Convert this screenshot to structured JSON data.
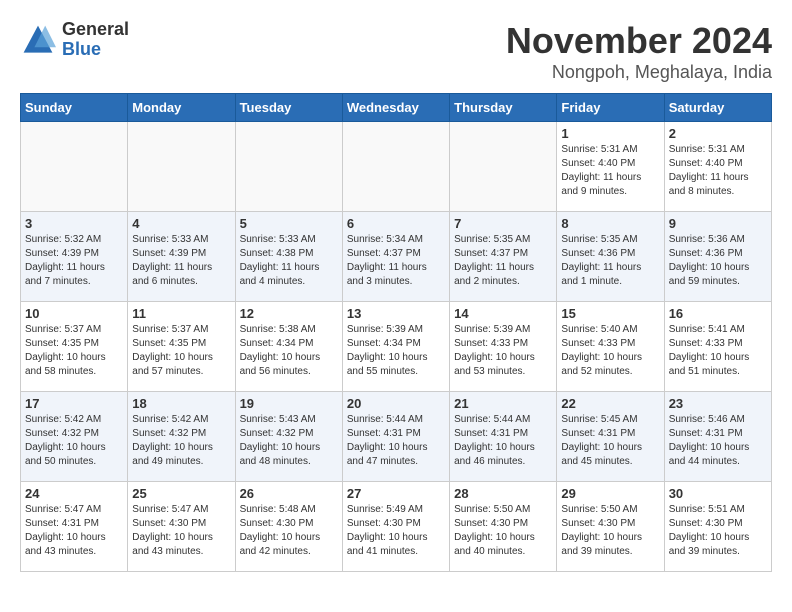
{
  "header": {
    "logo_general": "General",
    "logo_blue": "Blue",
    "month_title": "November 2024",
    "location": "Nongpoh, Meghalaya, India"
  },
  "weekdays": [
    "Sunday",
    "Monday",
    "Tuesday",
    "Wednesday",
    "Thursday",
    "Friday",
    "Saturday"
  ],
  "weeks": [
    {
      "days": [
        {
          "num": "",
          "info": ""
        },
        {
          "num": "",
          "info": ""
        },
        {
          "num": "",
          "info": ""
        },
        {
          "num": "",
          "info": ""
        },
        {
          "num": "",
          "info": ""
        },
        {
          "num": "1",
          "info": "Sunrise: 5:31 AM\nSunset: 4:40 PM\nDaylight: 11 hours\nand 9 minutes."
        },
        {
          "num": "2",
          "info": "Sunrise: 5:31 AM\nSunset: 4:40 PM\nDaylight: 11 hours\nand 8 minutes."
        }
      ]
    },
    {
      "days": [
        {
          "num": "3",
          "info": "Sunrise: 5:32 AM\nSunset: 4:39 PM\nDaylight: 11 hours\nand 7 minutes."
        },
        {
          "num": "4",
          "info": "Sunrise: 5:33 AM\nSunset: 4:39 PM\nDaylight: 11 hours\nand 6 minutes."
        },
        {
          "num": "5",
          "info": "Sunrise: 5:33 AM\nSunset: 4:38 PM\nDaylight: 11 hours\nand 4 minutes."
        },
        {
          "num": "6",
          "info": "Sunrise: 5:34 AM\nSunset: 4:37 PM\nDaylight: 11 hours\nand 3 minutes."
        },
        {
          "num": "7",
          "info": "Sunrise: 5:35 AM\nSunset: 4:37 PM\nDaylight: 11 hours\nand 2 minutes."
        },
        {
          "num": "8",
          "info": "Sunrise: 5:35 AM\nSunset: 4:36 PM\nDaylight: 11 hours\nand 1 minute."
        },
        {
          "num": "9",
          "info": "Sunrise: 5:36 AM\nSunset: 4:36 PM\nDaylight: 10 hours\nand 59 minutes."
        }
      ]
    },
    {
      "days": [
        {
          "num": "10",
          "info": "Sunrise: 5:37 AM\nSunset: 4:35 PM\nDaylight: 10 hours\nand 58 minutes."
        },
        {
          "num": "11",
          "info": "Sunrise: 5:37 AM\nSunset: 4:35 PM\nDaylight: 10 hours\nand 57 minutes."
        },
        {
          "num": "12",
          "info": "Sunrise: 5:38 AM\nSunset: 4:34 PM\nDaylight: 10 hours\nand 56 minutes."
        },
        {
          "num": "13",
          "info": "Sunrise: 5:39 AM\nSunset: 4:34 PM\nDaylight: 10 hours\nand 55 minutes."
        },
        {
          "num": "14",
          "info": "Sunrise: 5:39 AM\nSunset: 4:33 PM\nDaylight: 10 hours\nand 53 minutes."
        },
        {
          "num": "15",
          "info": "Sunrise: 5:40 AM\nSunset: 4:33 PM\nDaylight: 10 hours\nand 52 minutes."
        },
        {
          "num": "16",
          "info": "Sunrise: 5:41 AM\nSunset: 4:33 PM\nDaylight: 10 hours\nand 51 minutes."
        }
      ]
    },
    {
      "days": [
        {
          "num": "17",
          "info": "Sunrise: 5:42 AM\nSunset: 4:32 PM\nDaylight: 10 hours\nand 50 minutes."
        },
        {
          "num": "18",
          "info": "Sunrise: 5:42 AM\nSunset: 4:32 PM\nDaylight: 10 hours\nand 49 minutes."
        },
        {
          "num": "19",
          "info": "Sunrise: 5:43 AM\nSunset: 4:32 PM\nDaylight: 10 hours\nand 48 minutes."
        },
        {
          "num": "20",
          "info": "Sunrise: 5:44 AM\nSunset: 4:31 PM\nDaylight: 10 hours\nand 47 minutes."
        },
        {
          "num": "21",
          "info": "Sunrise: 5:44 AM\nSunset: 4:31 PM\nDaylight: 10 hours\nand 46 minutes."
        },
        {
          "num": "22",
          "info": "Sunrise: 5:45 AM\nSunset: 4:31 PM\nDaylight: 10 hours\nand 45 minutes."
        },
        {
          "num": "23",
          "info": "Sunrise: 5:46 AM\nSunset: 4:31 PM\nDaylight: 10 hours\nand 44 minutes."
        }
      ]
    },
    {
      "days": [
        {
          "num": "24",
          "info": "Sunrise: 5:47 AM\nSunset: 4:31 PM\nDaylight: 10 hours\nand 43 minutes."
        },
        {
          "num": "25",
          "info": "Sunrise: 5:47 AM\nSunset: 4:30 PM\nDaylight: 10 hours\nand 43 minutes."
        },
        {
          "num": "26",
          "info": "Sunrise: 5:48 AM\nSunset: 4:30 PM\nDaylight: 10 hours\nand 42 minutes."
        },
        {
          "num": "27",
          "info": "Sunrise: 5:49 AM\nSunset: 4:30 PM\nDaylight: 10 hours\nand 41 minutes."
        },
        {
          "num": "28",
          "info": "Sunrise: 5:50 AM\nSunset: 4:30 PM\nDaylight: 10 hours\nand 40 minutes."
        },
        {
          "num": "29",
          "info": "Sunrise: 5:50 AM\nSunset: 4:30 PM\nDaylight: 10 hours\nand 39 minutes."
        },
        {
          "num": "30",
          "info": "Sunrise: 5:51 AM\nSunset: 4:30 PM\nDaylight: 10 hours\nand 39 minutes."
        }
      ]
    }
  ]
}
